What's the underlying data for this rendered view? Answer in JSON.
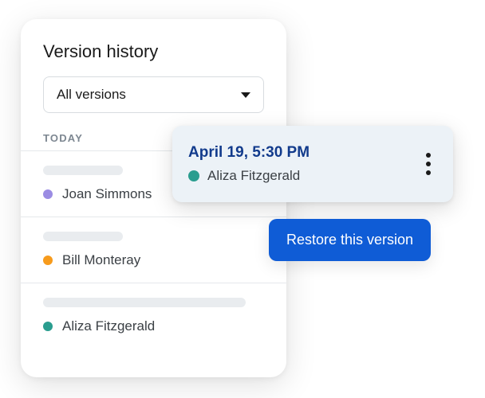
{
  "panel": {
    "title": "Version history",
    "dropdown": {
      "selected": "All versions"
    },
    "day_label": "TODAY",
    "versions": [
      {
        "author": "Joan Simmons",
        "color": "#9b8ce3"
      },
      {
        "author": "Bill Monteray",
        "color": "#f79b1c"
      },
      {
        "author": "Aliza Fitzgerald",
        "color": "#2a9d8f"
      }
    ]
  },
  "popover": {
    "timestamp": "April 19, 5:30 PM",
    "author": "Aliza Fitzgerald",
    "author_color": "#2a9d8f"
  },
  "restore": {
    "label": "Restore this version"
  }
}
